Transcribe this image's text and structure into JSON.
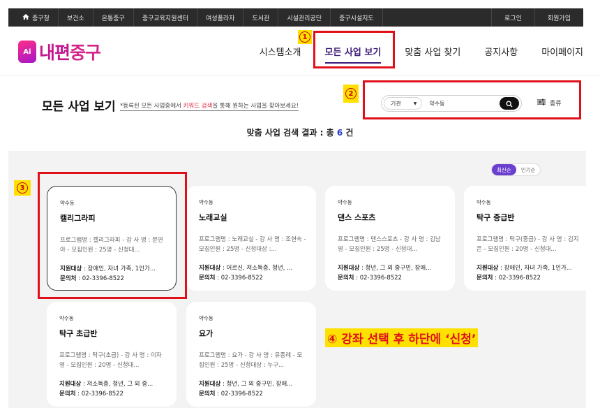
{
  "topbar": {
    "home_label": "중구청",
    "links": [
      "보건소",
      "온통중구",
      "중구교육지원센터",
      "여성플라자",
      "도서관",
      "시설관리공단",
      "중구시설지도"
    ],
    "right_links": [
      "로그인",
      "회원가입"
    ]
  },
  "header": {
    "logo_badge": "Ai",
    "logo_part1": "내편",
    "logo_part2": "중구",
    "nav": [
      "시스템소개",
      "모든 사업 보기",
      "맞춤 사업 찾기",
      "공지사항",
      "마이페이지"
    ]
  },
  "main": {
    "title": "모든 사업 보기",
    "subtitle_pre": "*등록된 모든 사업중에서 ",
    "subtitle_hl": "키워드 검색",
    "subtitle_post": "을 통해 원하는 사업을 찾아보세요!",
    "search": {
      "select_value": "기관",
      "input_value": "약수동"
    },
    "filter_label": "종류",
    "result_pre": "맞춤 사업 검색 결과 : 총 ",
    "result_count": "6",
    "result_post": " 건",
    "sort": [
      "최신순",
      "인기순"
    ]
  },
  "cards": [
    {
      "region": "약수동",
      "title": "캘리그라피",
      "desc": "프로그램명 : 캘리그라피 - 강 사 명 : 문연아 - 모집인원 : 25명 - 신청대...",
      "target_label": "지원대상",
      "target": " : 장애인, 자녀 가족, 1인가...",
      "contact_label": "문의처",
      "contact": " : 02-3396-8522"
    },
    {
      "region": "약수동",
      "title": "노래교실",
      "desc": "프로그램명 : 노래교실 - 강 사 명 : 조현숙 - 모집인원 : 25명 - 신청대상 :...",
      "target_label": "지원대상",
      "target": " : 어르신, 저소득층, 청년, ...",
      "contact_label": "문의처",
      "contact": " : 02-3396-8522"
    },
    {
      "region": "약수동",
      "title": "댄스 스포츠",
      "desc": "프로그램명 : 댄스스포츠 - 강 사 명 : 김남영 - 모집인원 : 25명 - 신청대...",
      "target_label": "지원대상",
      "target": " : 청년, 그 외 중구민, 장애...",
      "contact_label": "문의처",
      "contact": " : 02-3396-8522"
    },
    {
      "region": "약수동",
      "title": "탁구 중급반",
      "desc": "프로그램명 : 탁구(중급) - 강 사 명 : 김지은 - 모집인원 : 20명 - 신청대...",
      "target_label": "지원대상",
      "target": " : 장애인, 자녀 가족, 1인가...",
      "contact_label": "문의처",
      "contact": " : 02-3396-8522"
    },
    {
      "region": "약수동",
      "title": "탁구 초급반",
      "desc": "프로그램명 : 탁구(초급) - 강 사 명 : 이자영 - 모집인원 : 20명 - 신청대...",
      "target_label": "지원대상",
      "target": " : 저소득층, 청년, 그 외 중...",
      "contact_label": "문의처",
      "contact": " : 02-3396-8522"
    },
    {
      "region": "약수동",
      "title": "요가",
      "desc": "프로그램명 : 요가 - 강 사 명 : 유종례 - 모집인원 : 25명 - 신청대상 : 누구...",
      "target_label": "지원대상",
      "target": " : 청년, 그 외 중구민, 장애...",
      "contact_label": "문의처",
      "contact": " : 02-3396-8522"
    }
  ],
  "annotations": {
    "m1": "1",
    "m2": "2",
    "m3": "3",
    "note": "④ 강좌 선택 후 하단에 ‘신청’"
  },
  "colors": {
    "accent": "#3c1a7a",
    "highlight": "#e0283e",
    "count": "#2a3ec9",
    "annotation_red": "#e0101a",
    "annotation_yellow": "#ffe100"
  }
}
